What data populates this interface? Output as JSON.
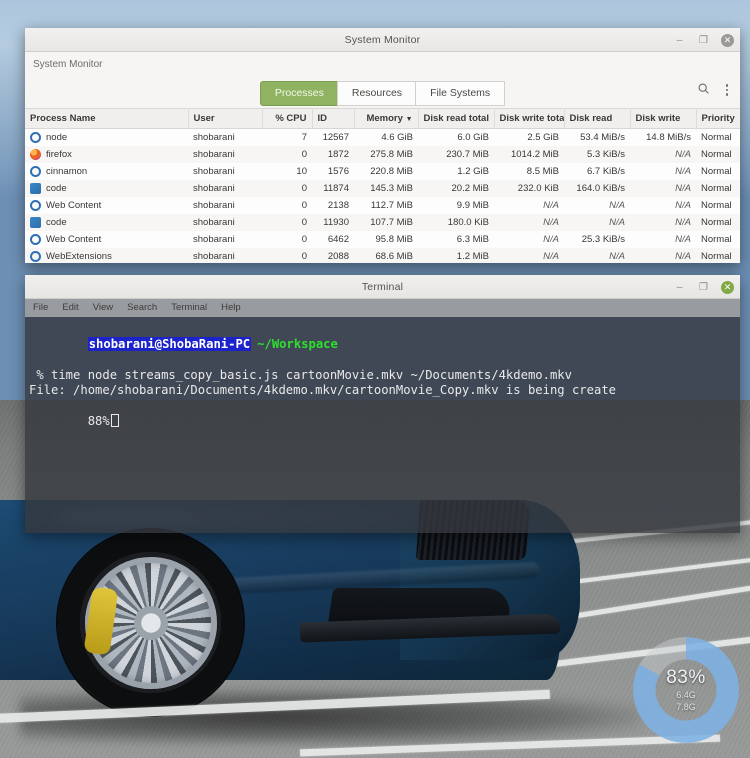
{
  "desktop": {
    "wallpaper_description": "blue sports car front wheel on asphalt parking lot"
  },
  "donut_widget": {
    "percent_label": "83%",
    "percent_value": 83,
    "used_label": "6.4G",
    "total_label": "7.8G",
    "accent_color": "#7fb2e5",
    "track_color": "#c8cdd0"
  },
  "system_monitor": {
    "title": "System Monitor",
    "subtitle": "System Monitor",
    "window_buttons": {
      "minimize": "–",
      "maximize": "❐",
      "close": "✕"
    },
    "tabs": [
      {
        "label": "Processes",
        "active": true
      },
      {
        "label": "Resources",
        "active": false
      },
      {
        "label": "File Systems",
        "active": false
      }
    ],
    "toolbar": {
      "search_icon": "search-icon",
      "menu_icon": "kebab-menu-icon"
    },
    "columns": [
      "Process Name",
      "User",
      "% CPU",
      "ID",
      "Memory",
      "Disk read total",
      "Disk write total",
      "Disk read",
      "Disk write",
      "Priority"
    ],
    "sorted_column": "Memory",
    "sort_indicator": "▼",
    "rows": [
      {
        "icon": "gear-icon",
        "name": "node",
        "user": "shobarani",
        "cpu": "7",
        "id": "12567",
        "memory": "4.6 GiB",
        "disk_read_total": "6.0 GiB",
        "disk_write_total": "2.5 GiB",
        "disk_read": "53.4 MiB/s",
        "disk_write": "14.8 MiB/s",
        "priority": "Normal"
      },
      {
        "icon": "firefox-icon",
        "name": "firefox",
        "user": "shobarani",
        "cpu": "0",
        "id": "1872",
        "memory": "275.8 MiB",
        "disk_read_total": "230.7 MiB",
        "disk_write_total": "1014.2 MiB",
        "disk_read": "5.3 KiB/s",
        "disk_write": "N/A",
        "priority": "Normal"
      },
      {
        "icon": "gear-icon",
        "name": "cinnamon",
        "user": "shobarani",
        "cpu": "10",
        "id": "1576",
        "memory": "220.8 MiB",
        "disk_read_total": "1.2 GiB",
        "disk_write_total": "8.5 MiB",
        "disk_read": "6.7 KiB/s",
        "disk_write": "N/A",
        "priority": "Normal"
      },
      {
        "icon": "code-icon",
        "name": "code",
        "user": "shobarani",
        "cpu": "0",
        "id": "11874",
        "memory": "145.3 MiB",
        "disk_read_total": "20.2 MiB",
        "disk_write_total": "232.0 KiB",
        "disk_read": "164.0 KiB/s",
        "disk_write": "N/A",
        "priority": "Normal"
      },
      {
        "icon": "gear-icon",
        "name": "Web Content",
        "user": "shobarani",
        "cpu": "0",
        "id": "2138",
        "memory": "112.7 MiB",
        "disk_read_total": "9.9 MiB",
        "disk_write_total": "N/A",
        "disk_read": "N/A",
        "disk_write": "N/A",
        "priority": "Normal"
      },
      {
        "icon": "code-icon",
        "name": "code",
        "user": "shobarani",
        "cpu": "0",
        "id": "11930",
        "memory": "107.7 MiB",
        "disk_read_total": "180.0 KiB",
        "disk_write_total": "N/A",
        "disk_read": "N/A",
        "disk_write": "N/A",
        "priority": "Normal"
      },
      {
        "icon": "gear-icon",
        "name": "Web Content",
        "user": "shobarani",
        "cpu": "0",
        "id": "6462",
        "memory": "95.8 MiB",
        "disk_read_total": "6.3 MiB",
        "disk_write_total": "N/A",
        "disk_read": "25.3 KiB/s",
        "disk_write": "N/A",
        "priority": "Normal"
      },
      {
        "icon": "gear-icon",
        "name": "WebExtensions",
        "user": "shobarani",
        "cpu": "0",
        "id": "2088",
        "memory": "68.6 MiB",
        "disk_read_total": "1.2 MiB",
        "disk_write_total": "N/A",
        "disk_read": "N/A",
        "disk_write": "N/A",
        "priority": "Normal"
      }
    ]
  },
  "terminal": {
    "title": "Terminal",
    "window_buttons": {
      "minimize": "–",
      "maximize": "❐",
      "close": "✕"
    },
    "menu": [
      "File",
      "Edit",
      "View",
      "Search",
      "Terminal",
      "Help"
    ],
    "prompt_user_host": "shobarani@ShobaRani-PC",
    "prompt_path": "~/Workspace",
    "command_line": " % time node streams_copy_basic.js cartoonMovie.mkv ~/Documents/4kdemo.mkv",
    "output_line": "File: /home/shobarani/Documents/4kdemo.mkv/cartoonMovie_Copy.mkv is being create",
    "progress_line": "88%",
    "colors": {
      "host_bg": "#1c23c8",
      "path_fg": "#2ee02e",
      "text_fg": "#e9e9e9"
    }
  }
}
